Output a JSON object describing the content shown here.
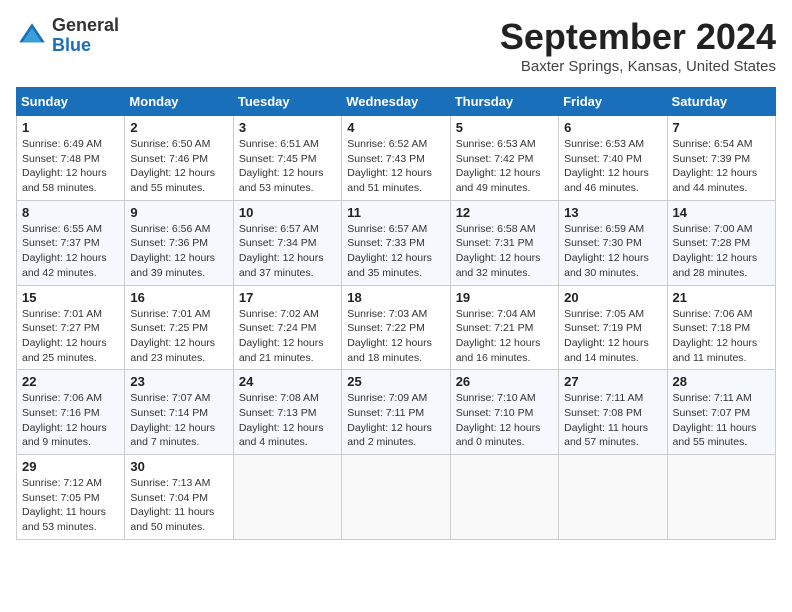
{
  "header": {
    "logo_line1": "General",
    "logo_line2": "Blue",
    "month_title": "September 2024",
    "location": "Baxter Springs, Kansas, United States"
  },
  "days_of_week": [
    "Sunday",
    "Monday",
    "Tuesday",
    "Wednesday",
    "Thursday",
    "Friday",
    "Saturday"
  ],
  "weeks": [
    [
      {
        "day": "1",
        "detail": "Sunrise: 6:49 AM\nSunset: 7:48 PM\nDaylight: 12 hours\nand 58 minutes."
      },
      {
        "day": "2",
        "detail": "Sunrise: 6:50 AM\nSunset: 7:46 PM\nDaylight: 12 hours\nand 55 minutes."
      },
      {
        "day": "3",
        "detail": "Sunrise: 6:51 AM\nSunset: 7:45 PM\nDaylight: 12 hours\nand 53 minutes."
      },
      {
        "day": "4",
        "detail": "Sunrise: 6:52 AM\nSunset: 7:43 PM\nDaylight: 12 hours\nand 51 minutes."
      },
      {
        "day": "5",
        "detail": "Sunrise: 6:53 AM\nSunset: 7:42 PM\nDaylight: 12 hours\nand 49 minutes."
      },
      {
        "day": "6",
        "detail": "Sunrise: 6:53 AM\nSunset: 7:40 PM\nDaylight: 12 hours\nand 46 minutes."
      },
      {
        "day": "7",
        "detail": "Sunrise: 6:54 AM\nSunset: 7:39 PM\nDaylight: 12 hours\nand 44 minutes."
      }
    ],
    [
      {
        "day": "8",
        "detail": "Sunrise: 6:55 AM\nSunset: 7:37 PM\nDaylight: 12 hours\nand 42 minutes."
      },
      {
        "day": "9",
        "detail": "Sunrise: 6:56 AM\nSunset: 7:36 PM\nDaylight: 12 hours\nand 39 minutes."
      },
      {
        "day": "10",
        "detail": "Sunrise: 6:57 AM\nSunset: 7:34 PM\nDaylight: 12 hours\nand 37 minutes."
      },
      {
        "day": "11",
        "detail": "Sunrise: 6:57 AM\nSunset: 7:33 PM\nDaylight: 12 hours\nand 35 minutes."
      },
      {
        "day": "12",
        "detail": "Sunrise: 6:58 AM\nSunset: 7:31 PM\nDaylight: 12 hours\nand 32 minutes."
      },
      {
        "day": "13",
        "detail": "Sunrise: 6:59 AM\nSunset: 7:30 PM\nDaylight: 12 hours\nand 30 minutes."
      },
      {
        "day": "14",
        "detail": "Sunrise: 7:00 AM\nSunset: 7:28 PM\nDaylight: 12 hours\nand 28 minutes."
      }
    ],
    [
      {
        "day": "15",
        "detail": "Sunrise: 7:01 AM\nSunset: 7:27 PM\nDaylight: 12 hours\nand 25 minutes."
      },
      {
        "day": "16",
        "detail": "Sunrise: 7:01 AM\nSunset: 7:25 PM\nDaylight: 12 hours\nand 23 minutes."
      },
      {
        "day": "17",
        "detail": "Sunrise: 7:02 AM\nSunset: 7:24 PM\nDaylight: 12 hours\nand 21 minutes."
      },
      {
        "day": "18",
        "detail": "Sunrise: 7:03 AM\nSunset: 7:22 PM\nDaylight: 12 hours\nand 18 minutes."
      },
      {
        "day": "19",
        "detail": "Sunrise: 7:04 AM\nSunset: 7:21 PM\nDaylight: 12 hours\nand 16 minutes."
      },
      {
        "day": "20",
        "detail": "Sunrise: 7:05 AM\nSunset: 7:19 PM\nDaylight: 12 hours\nand 14 minutes."
      },
      {
        "day": "21",
        "detail": "Sunrise: 7:06 AM\nSunset: 7:18 PM\nDaylight: 12 hours\nand 11 minutes."
      }
    ],
    [
      {
        "day": "22",
        "detail": "Sunrise: 7:06 AM\nSunset: 7:16 PM\nDaylight: 12 hours\nand 9 minutes."
      },
      {
        "day": "23",
        "detail": "Sunrise: 7:07 AM\nSunset: 7:14 PM\nDaylight: 12 hours\nand 7 minutes."
      },
      {
        "day": "24",
        "detail": "Sunrise: 7:08 AM\nSunset: 7:13 PM\nDaylight: 12 hours\nand 4 minutes."
      },
      {
        "day": "25",
        "detail": "Sunrise: 7:09 AM\nSunset: 7:11 PM\nDaylight: 12 hours\nand 2 minutes."
      },
      {
        "day": "26",
        "detail": "Sunrise: 7:10 AM\nSunset: 7:10 PM\nDaylight: 12 hours\nand 0 minutes."
      },
      {
        "day": "27",
        "detail": "Sunrise: 7:11 AM\nSunset: 7:08 PM\nDaylight: 11 hours\nand 57 minutes."
      },
      {
        "day": "28",
        "detail": "Sunrise: 7:11 AM\nSunset: 7:07 PM\nDaylight: 11 hours\nand 55 minutes."
      }
    ],
    [
      {
        "day": "29",
        "detail": "Sunrise: 7:12 AM\nSunset: 7:05 PM\nDaylight: 11 hours\nand 53 minutes."
      },
      {
        "day": "30",
        "detail": "Sunrise: 7:13 AM\nSunset: 7:04 PM\nDaylight: 11 hours\nand 50 minutes."
      },
      {
        "day": "",
        "detail": ""
      },
      {
        "day": "",
        "detail": ""
      },
      {
        "day": "",
        "detail": ""
      },
      {
        "day": "",
        "detail": ""
      },
      {
        "day": "",
        "detail": ""
      }
    ]
  ]
}
